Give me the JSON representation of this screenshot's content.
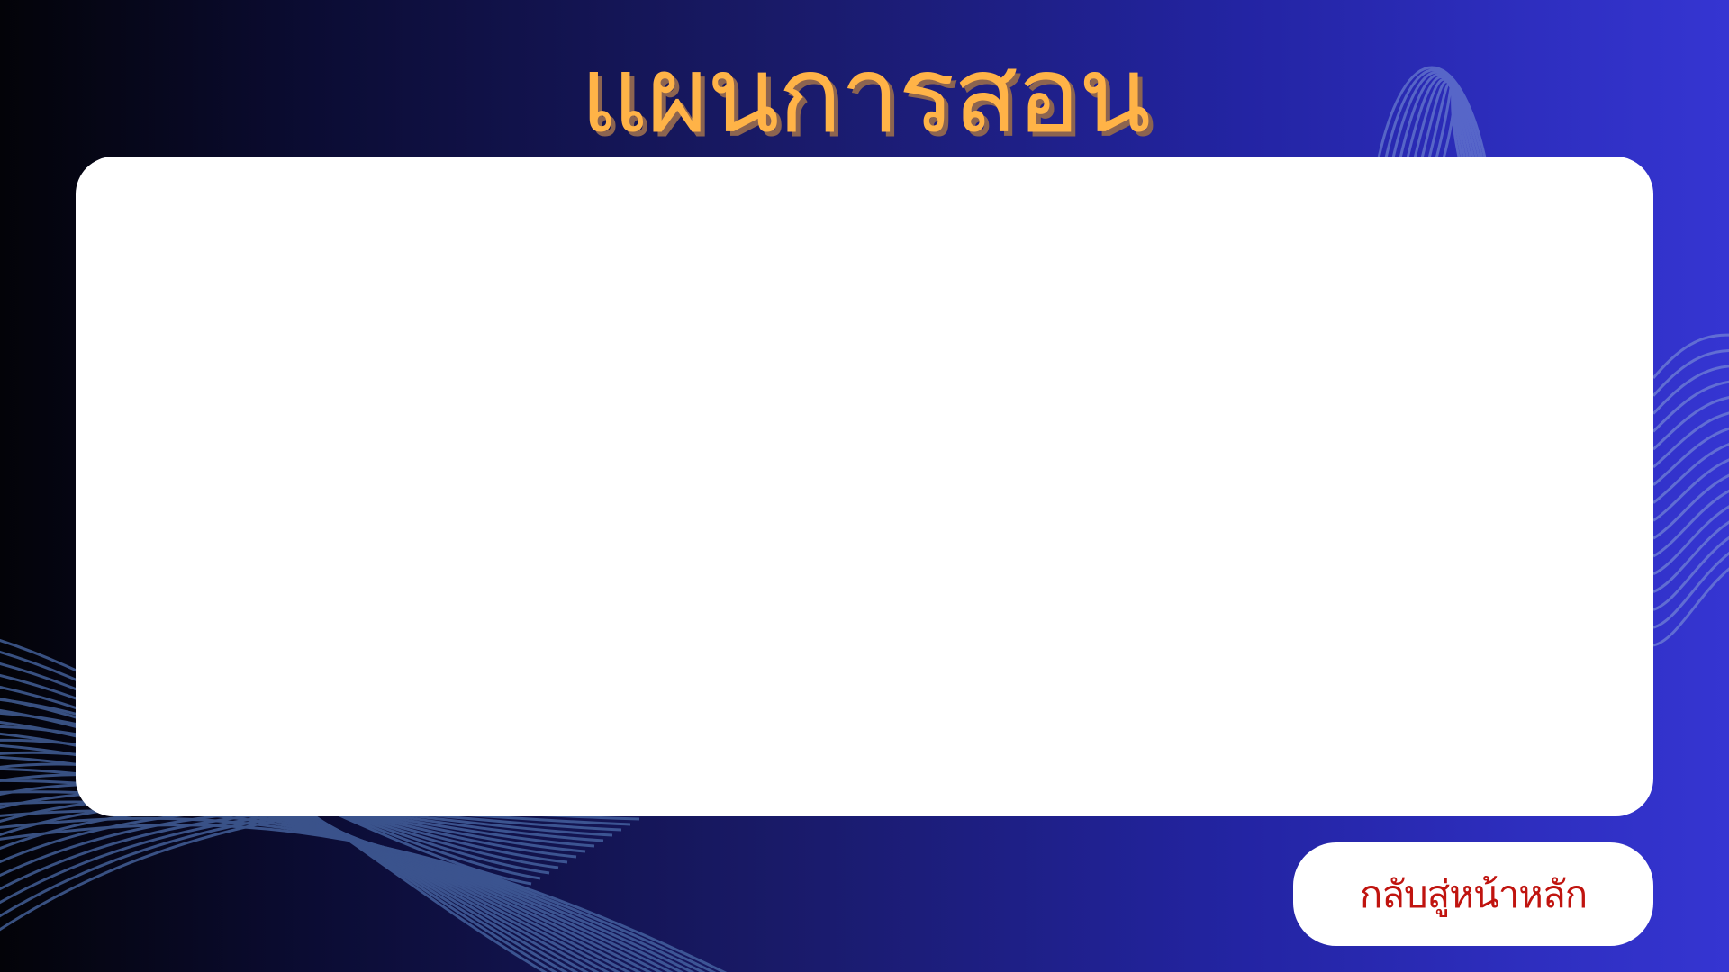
{
  "slide": {
    "title": "แผนการสอน"
  },
  "navigation": {
    "home_button_label": "กลับสู่หน้าหลัก"
  },
  "colors": {
    "title": "#ffb347",
    "title_shadow": "#8c6450",
    "button_text": "#c0140f",
    "panel": "#ffffff",
    "background_left": "#030308",
    "background_right": "#3535d2",
    "wave_lines": "#5a7ab8"
  }
}
